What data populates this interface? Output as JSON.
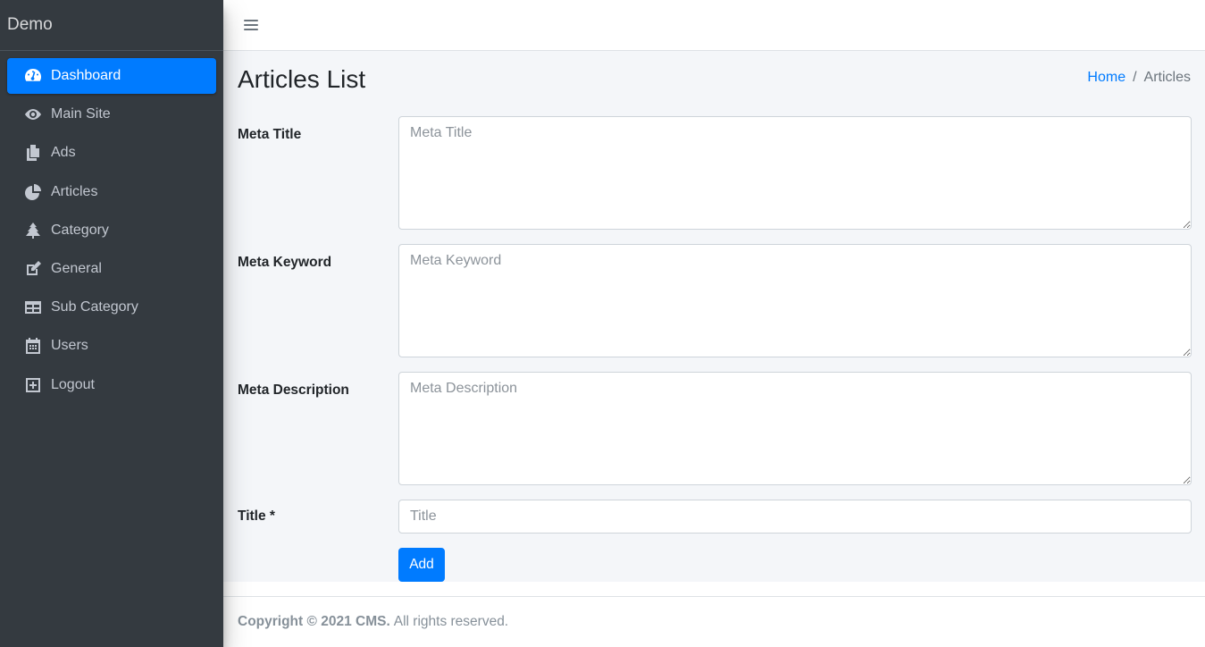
{
  "brand": {
    "name": "Demo"
  },
  "sidebar": {
    "items": [
      {
        "label": "Dashboard",
        "icon": "tachometer-icon",
        "active": true
      },
      {
        "label": "Main Site",
        "icon": "eye-icon",
        "active": false
      },
      {
        "label": "Ads",
        "icon": "copy-icon",
        "active": false
      },
      {
        "label": "Articles",
        "icon": "chart-pie-icon",
        "active": false
      },
      {
        "label": "Category",
        "icon": "tree-icon",
        "active": false
      },
      {
        "label": "General",
        "icon": "edit-icon",
        "active": false
      },
      {
        "label": "Sub Category",
        "icon": "table-icon",
        "active": false
      },
      {
        "label": "Users",
        "icon": "calendar-icon",
        "active": false
      },
      {
        "label": "Logout",
        "icon": "plus-square-icon",
        "active": false
      }
    ]
  },
  "header": {
    "menu_icon": "bars-icon"
  },
  "page": {
    "title": "Articles List",
    "breadcrumb": {
      "home": "Home",
      "separator": "/",
      "current": "Articles"
    }
  },
  "form": {
    "meta_title": {
      "label": "Meta Title",
      "placeholder": "Meta Title",
      "value": ""
    },
    "meta_keyword": {
      "label": "Meta Keyword",
      "placeholder": "Meta Keyword",
      "value": ""
    },
    "meta_description": {
      "label": "Meta Description",
      "placeholder": "Meta Description",
      "value": ""
    },
    "title": {
      "label": "Title *",
      "placeholder": "Title",
      "value": ""
    },
    "submit_label": "Add"
  },
  "footer": {
    "copyright": "Copyright © 2021 CMS.",
    "rights": "All rights reserved."
  },
  "colors": {
    "sidebar_bg": "#343a40",
    "accent": "#007bff",
    "content_bg": "#f4f6f9"
  }
}
